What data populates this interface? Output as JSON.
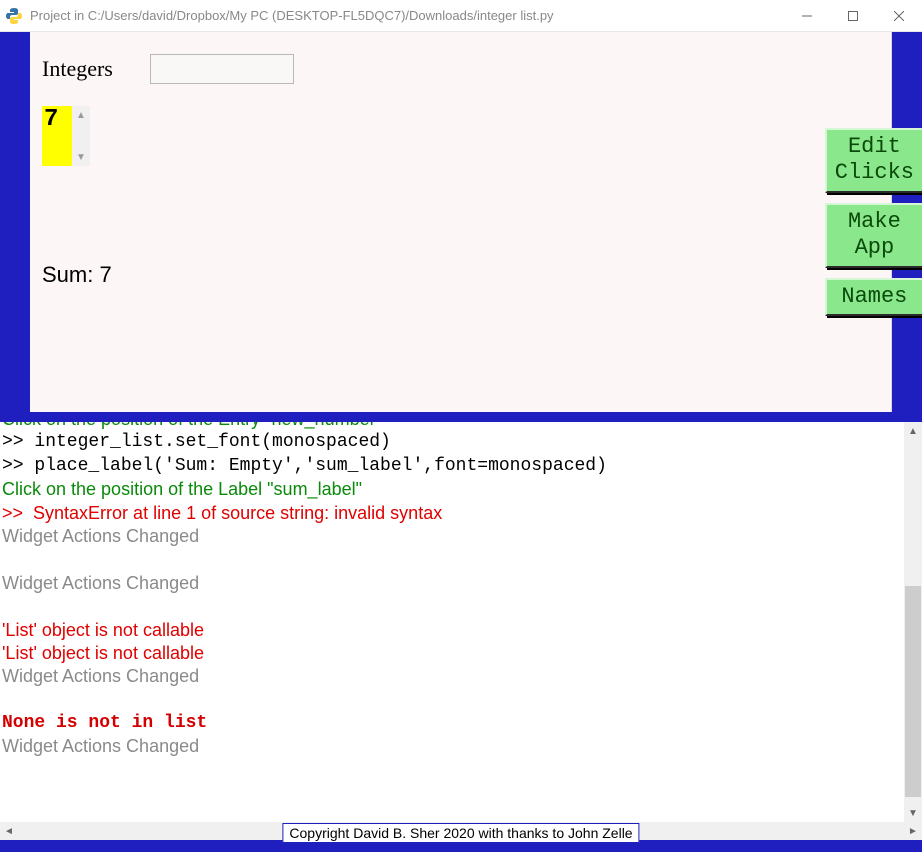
{
  "window": {
    "title": "Project in C:/Users/david/Dropbox/My PC (DESKTOP-FL5DQC7)/Downloads/integer list.py"
  },
  "form": {
    "integers_label": "Integers",
    "new_number_value": "",
    "listbox_value": "7",
    "sum_label": "Sum: 7"
  },
  "buttons": {
    "edit_clicks": "Edit\nClicks",
    "make_app": "Make\nApp",
    "names": "Names"
  },
  "console": {
    "lines": [
      {
        "text": "Click on the position of the Entry \"new_number\"",
        "cls": "sans c-green cut"
      },
      {
        "text": ">> integer_list.set_font(monospaced)",
        "cls": "mono c-black"
      },
      {
        "text": ">> place_label('Sum: Empty','sum_label',font=monospaced)",
        "cls": "mono c-black"
      },
      {
        "text": "Click on the position of the Label \"sum_label\"",
        "cls": "sans c-green"
      },
      {
        "text": ">>  SyntaxError at line 1 of source string: invalid syntax",
        "cls": "sans c-red"
      },
      {
        "text": "Widget Actions Changed",
        "cls": "sans c-gray"
      },
      {
        "text": " ",
        "cls": "sans"
      },
      {
        "text": "Widget Actions Changed",
        "cls": "sans c-gray"
      },
      {
        "text": " ",
        "cls": "sans"
      },
      {
        "text": "'List' object is not callable",
        "cls": "sans c-red"
      },
      {
        "text": "'List' object is not callable",
        "cls": "sans c-red"
      },
      {
        "text": "Widget Actions Changed",
        "cls": "sans c-gray"
      },
      {
        "text": " ",
        "cls": "sans"
      },
      {
        "text": "None is not in list",
        "cls": "mono c-boldred"
      },
      {
        "text": "Widget Actions Changed",
        "cls": "sans c-gray"
      }
    ]
  },
  "footer": {
    "copyright": "Copyright David B. Sher 2020 with thanks to John Zelle"
  }
}
